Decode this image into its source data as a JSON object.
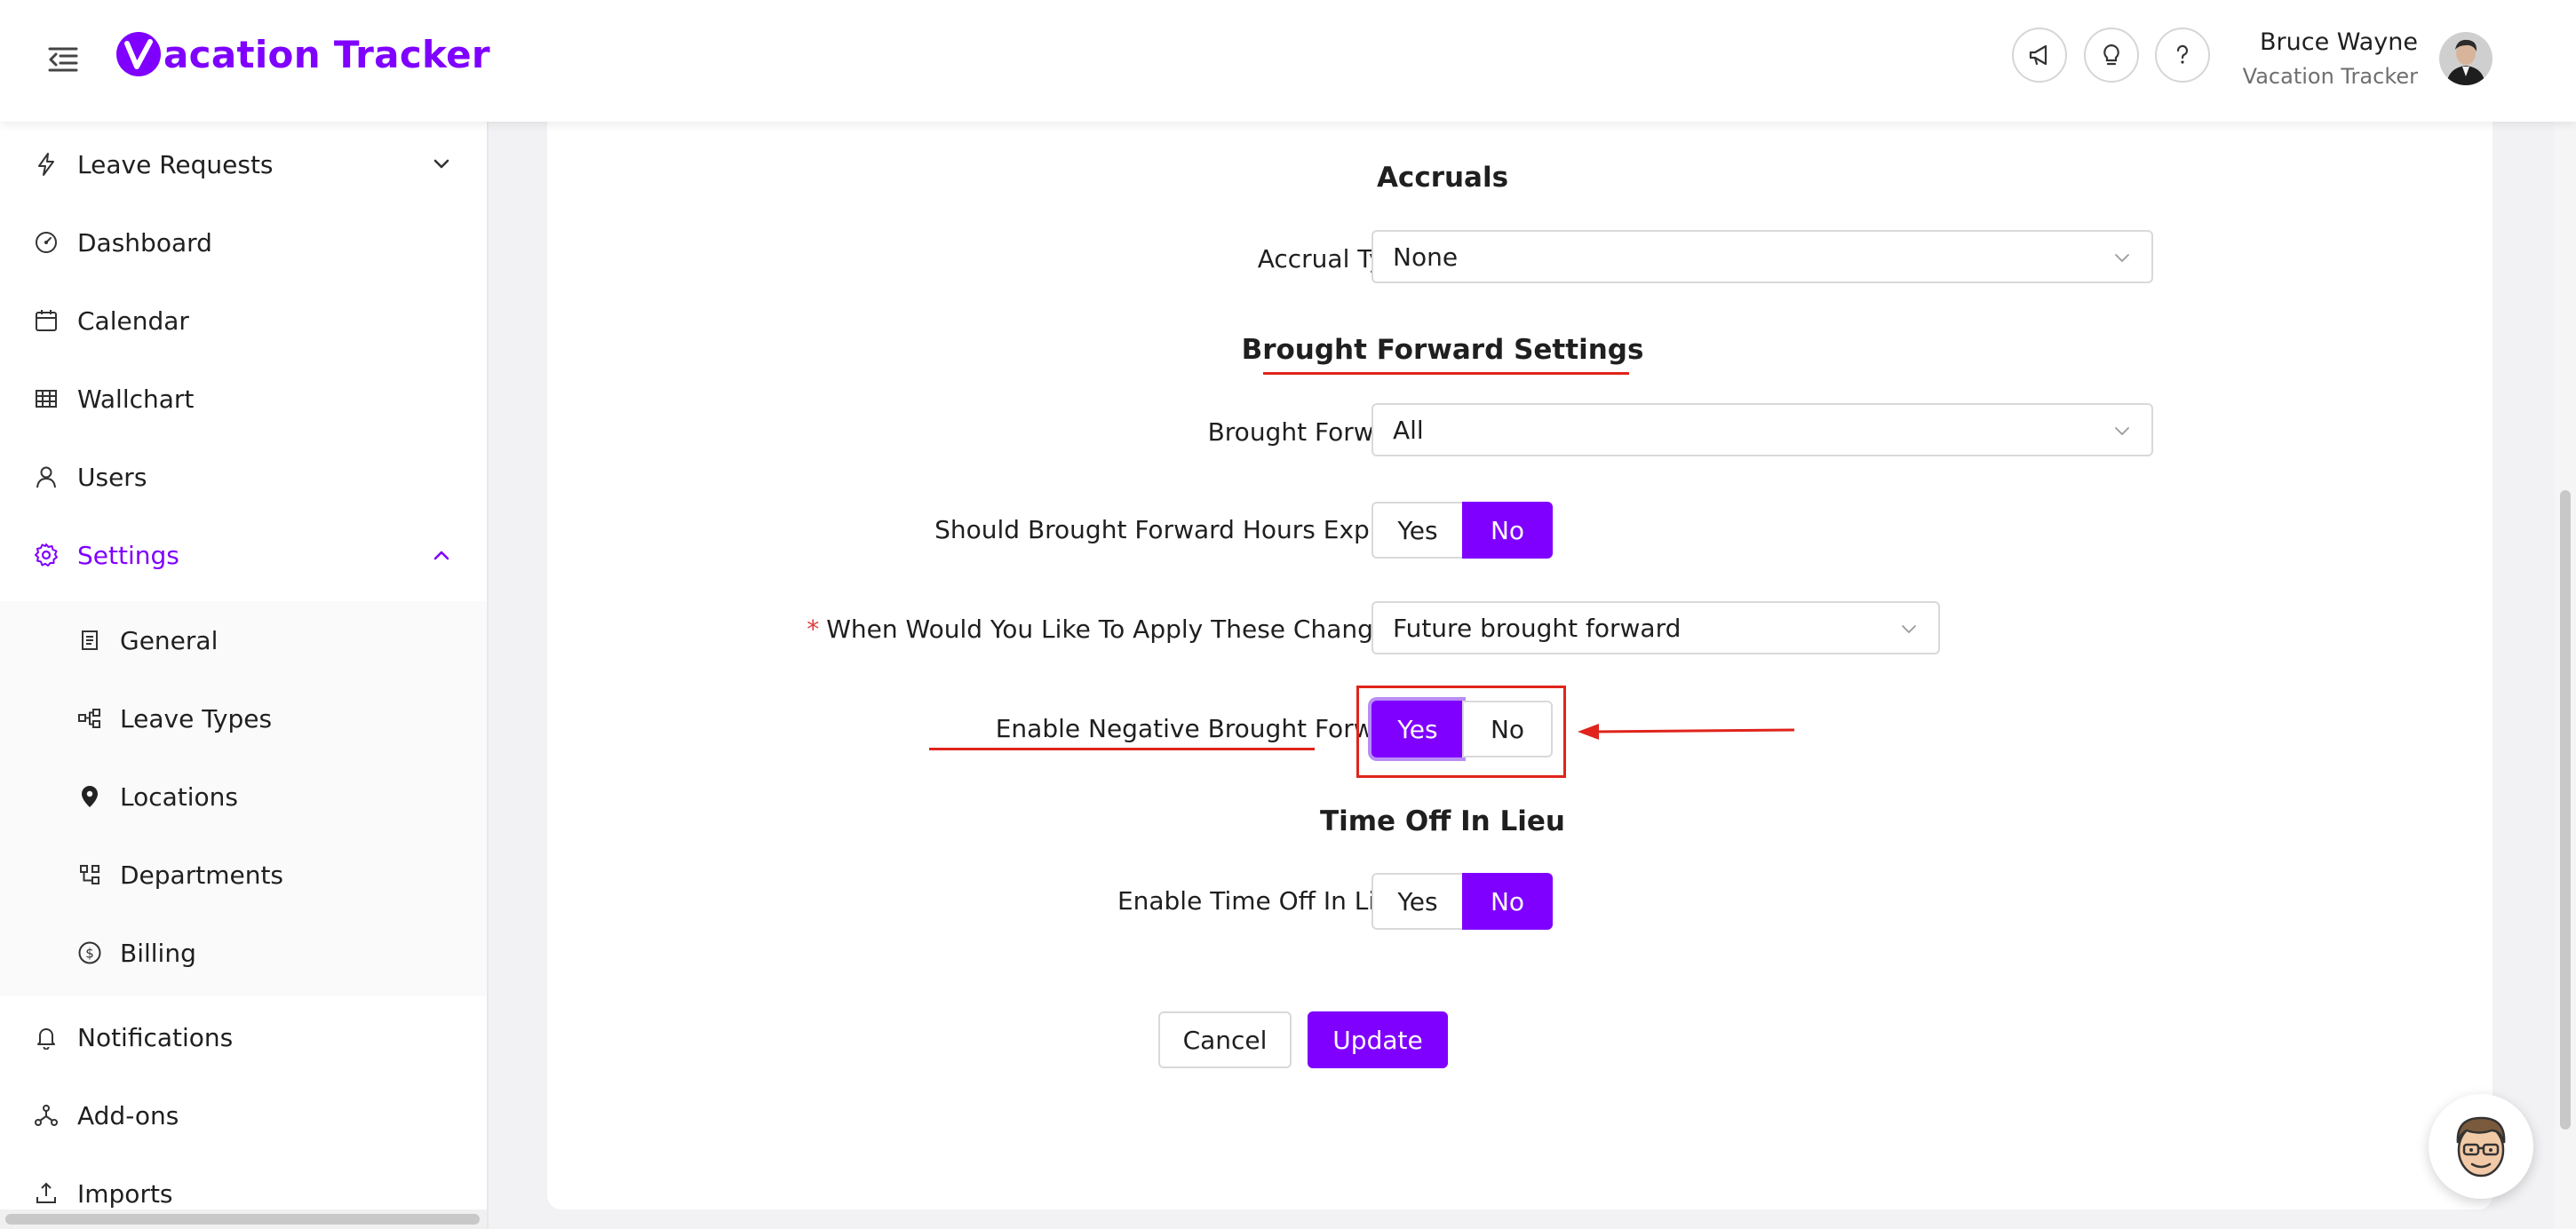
{
  "app": {
    "brand_name": "acation Tracker",
    "brand_color": "#7f00ff"
  },
  "header": {
    "icons": [
      "megaphone-icon",
      "lightbulb-icon",
      "question-icon"
    ],
    "user_name": "Bruce Wayne",
    "user_company": "Vacation Tracker"
  },
  "sidebar": {
    "items": [
      {
        "label": "Leave Requests",
        "icon": "lightning-icon",
        "chevron": "down"
      },
      {
        "label": "Dashboard",
        "icon": "gauge-icon"
      },
      {
        "label": "Calendar",
        "icon": "calendar-icon"
      },
      {
        "label": "Wallchart",
        "icon": "table-icon"
      },
      {
        "label": "Users",
        "icon": "user-icon"
      },
      {
        "label": "Settings",
        "icon": "gear-icon",
        "active": true,
        "chevron": "up"
      },
      {
        "label": "Notifications",
        "icon": "bell-icon"
      },
      {
        "label": "Add-ons",
        "icon": "addons-icon"
      },
      {
        "label": "Imports",
        "icon": "import-icon"
      }
    ],
    "settings_submenu": [
      {
        "label": "General",
        "icon": "document-icon"
      },
      {
        "label": "Leave Types",
        "icon": "leave-types-icon"
      },
      {
        "label": "Locations",
        "icon": "location-pin-icon"
      },
      {
        "label": "Departments",
        "icon": "departments-icon"
      },
      {
        "label": "Billing",
        "icon": "dollar-icon"
      }
    ]
  },
  "form": {
    "accruals_title": "Accruals",
    "accrual_type_label": "Accrual Type",
    "accrual_type_value": "None",
    "brought_forward_title": "Brought Forward Settings",
    "brought_forward_label": "Brought Forward",
    "brought_forward_value": "All",
    "expire_label": "Should Brought Forward Hours Expire?",
    "expire_selected": "No",
    "apply_label": "When Would You Like To Apply These Changes?",
    "apply_required_mark": "*",
    "apply_value": "Future brought forward",
    "negative_label": "Enable Negative Brought Forward",
    "negative_selected": "Yes",
    "toil_title": "Time Off In Lieu",
    "toil_label": "Enable Time Off In Lieu:",
    "toil_selected": "No",
    "yes_label": "Yes",
    "no_label": "No",
    "colon": ":",
    "cancel_label": "Cancel",
    "update_label": "Update"
  },
  "annotation": {
    "color": "#e0241b"
  }
}
